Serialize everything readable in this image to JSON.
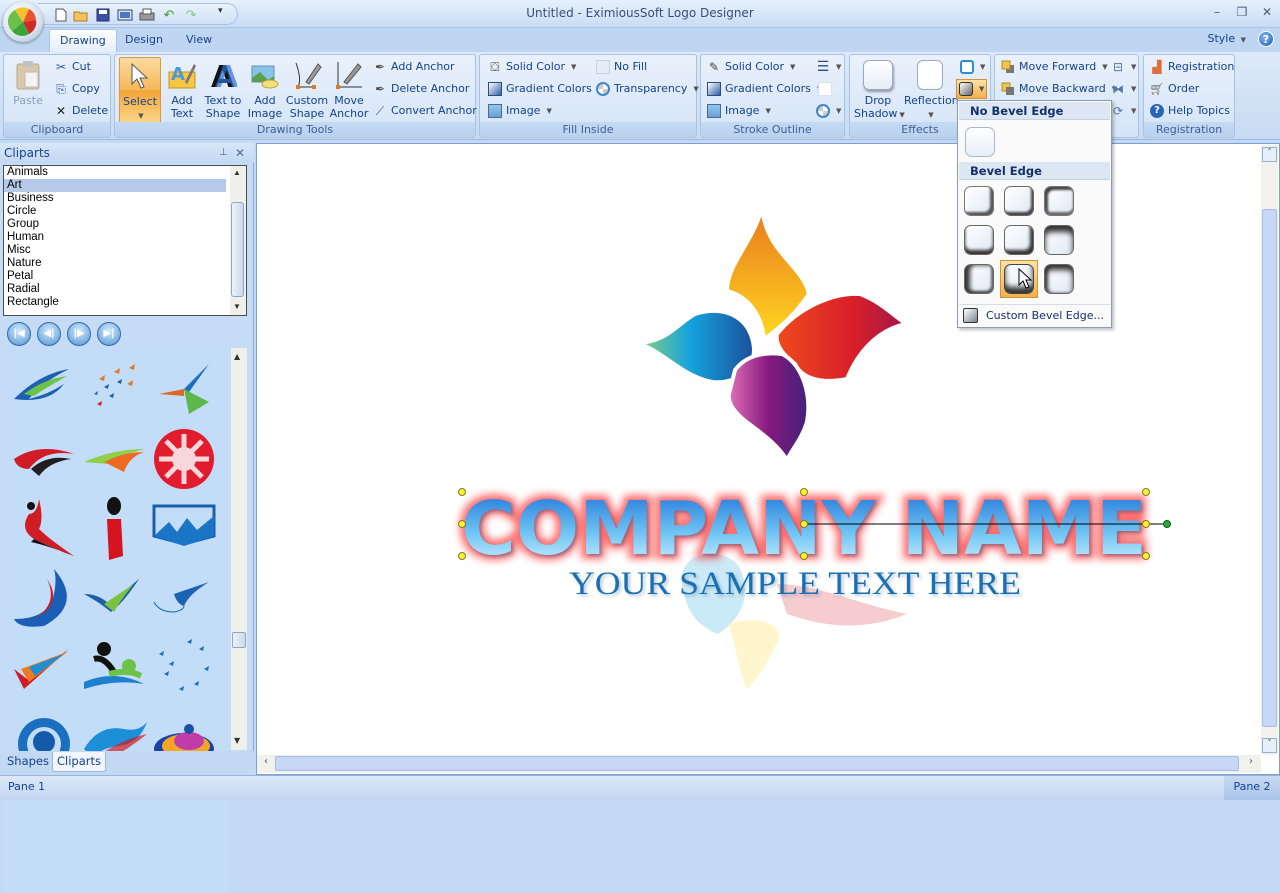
{
  "window": {
    "title": "Untitled - EximiousSoft Logo Designer",
    "controls": {
      "minimize": "–",
      "restore": "❐",
      "close": "✕"
    }
  },
  "quick_access": {
    "icons": [
      "new-document-icon",
      "open-folder-icon",
      "save-icon",
      "image-icon",
      "print-icon",
      "undo-icon",
      "redo-icon"
    ],
    "more": "▾"
  },
  "tabs": [
    {
      "label": "Drawing",
      "active": true
    },
    {
      "label": "Design",
      "active": false
    },
    {
      "label": "View",
      "active": false
    }
  ],
  "style_menu": {
    "label": "Style",
    "help": "?"
  },
  "ribbon": {
    "clipboard": {
      "label": "Clipboard",
      "paste": "Paste",
      "cut": "Cut",
      "copy": "Copy",
      "delete": "Delete"
    },
    "drawing_tools": {
      "label": "Drawing Tools",
      "select": "Select",
      "add_text_1": "Add",
      "add_text_2": "Text",
      "text_to_shape_1": "Text to",
      "text_to_shape_2": "Shape",
      "add_image_1": "Add",
      "add_image_2": "Image",
      "custom_shape_1": "Custom",
      "custom_shape_2": "Shape",
      "move_anchor_1": "Move",
      "move_anchor_2": "Anchor",
      "add_anchor": "Add Anchor",
      "delete_anchor": "Delete Anchor",
      "convert_anchor": "Convert Anchor"
    },
    "fill_inside": {
      "label": "Fill Inside",
      "solid_color": "Solid Color",
      "no_fill": "No Fill",
      "gradient_colors": "Gradient Colors",
      "transparency": "Transparency",
      "image": "Image"
    },
    "stroke_outline": {
      "label": "Stroke Outline",
      "solid_color": "Solid Color",
      "gradient_colors": "Gradient Colors",
      "image": "Image"
    },
    "effects": {
      "label": "Effects",
      "drop_shadow_1": "Drop",
      "drop_shadow_2": "Shadow",
      "reflection": "Reflection"
    },
    "arrange": {
      "move_forward": "Move Forward",
      "move_backward": "Move Backward"
    },
    "registration": {
      "label": "Registration",
      "registration": "Registration",
      "order": "Order",
      "help_topics": "Help Topics"
    }
  },
  "bevel_menu": {
    "no_bevel_header": "No Bevel Edge",
    "bevel_header": "Bevel Edge",
    "custom": "Custom Bevel Edge...",
    "selected_index": 7,
    "presets": 9
  },
  "left_pane": {
    "title": "Cliparts",
    "pin": "⊥",
    "close": "✕",
    "categories": [
      "Animals",
      "Art",
      "Business",
      "Circle",
      "Group",
      "Human",
      "Misc",
      "Nature",
      "Petal",
      "Radial",
      "Rectangle"
    ],
    "selected_category": "Art",
    "nav": [
      "first",
      "previous",
      "next",
      "last"
    ],
    "cliparts": [
      "swoosh-blue-green",
      "birds-flock",
      "three-point-star",
      "red-black-swoosh",
      "green-orange-swoosh",
      "red-sun-circle",
      "dancer-figure",
      "letter-i-person",
      "blue-mountain-badge",
      "blue-red-crescent",
      "green-check-bird",
      "blue-bird-line",
      "tricolor-check",
      "people-swoosh",
      "blue-birds-circle",
      "blue-ring",
      "blue-wave",
      "planet-orange"
    ],
    "bottom_tabs": [
      {
        "label": "Shapes",
        "active": false
      },
      {
        "label": "Cliparts",
        "active": true
      }
    ]
  },
  "canvas": {
    "headline": "COMPANY NAME",
    "tagline": "YOUR SAMPLE TEXT HERE"
  },
  "status": {
    "pane1": "Pane 1",
    "pane2": "Pane 2"
  }
}
